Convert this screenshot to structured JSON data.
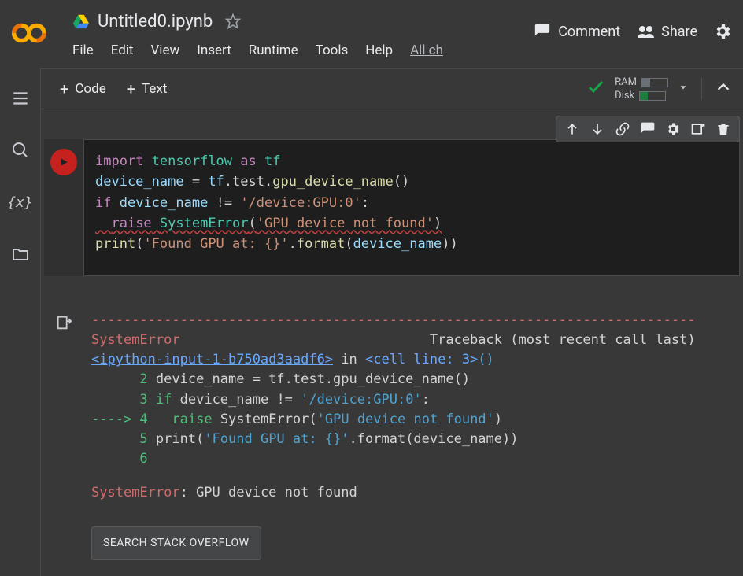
{
  "header": {
    "filename": "Untitled0.ipynb",
    "menu": [
      "File",
      "Edit",
      "View",
      "Insert",
      "Runtime",
      "Tools",
      "Help"
    ],
    "menu_extra_link": "All ch",
    "actions": {
      "comment": "Comment",
      "share": "Share"
    }
  },
  "toolbar": {
    "code_label": "Code",
    "text_label": "Text",
    "resources": {
      "ram_label": "RAM",
      "disk_label": "Disk"
    }
  },
  "code": {
    "l1": {
      "import": "import",
      "mod": "tensorflow",
      "as": "as",
      "alias": "tf"
    },
    "l2": {
      "lhs": "device_name",
      "eq": " = ",
      "a": "tf",
      "b": ".test.",
      "fn": "gpu_device_name",
      "par": "()"
    },
    "l3": {
      "if": "if",
      "sp1": " ",
      "var": "device_name",
      "sp2": " ",
      "neq": "!=",
      "sp3": " ",
      "str": "'/device:GPU:0'",
      "colon": ":"
    },
    "l4": {
      "indent": "  ",
      "raise": "raise",
      "sp": " ",
      "err": "SystemError",
      "open": "(",
      "str": "'GPU device not found'",
      "close": ")"
    },
    "l5": {
      "fn": "print",
      "open": "(",
      "str": "'Found GPU at: {}'",
      "dot": ".",
      "fmt": "format",
      "open2": "(",
      "arg": "device_name",
      "close2": ")",
      "close": ")"
    }
  },
  "output": {
    "err_name": "SystemError",
    "traceback_label": "Traceback (most recent call last)",
    "link_text": "<ipython-input-1-b750ad3aadf6>",
    "in_word": " in ",
    "cell_line": "<cell line: 3>",
    "paren": "()",
    "lines": [
      {
        "num": "      2",
        "body": " device_name = tf.test.gpu_device_name()"
      },
      {
        "num": "      3",
        "body_pre": " ",
        "kw": "if",
        "body_post": " device_name != ",
        "str": "'/device:GPU:0'",
        "tail": ":"
      },
      {
        "arrow": "----> ",
        "num": "4",
        "body_pre": "   ",
        "kw": "raise",
        "body_post": " SystemError(",
        "str": "'GPU device not found'",
        "tail": ")"
      },
      {
        "num": "      5",
        "body_pre": " print(",
        "str": "'Found GPU at: {}'",
        "body_post": ".format(device_name))"
      },
      {
        "num": "      6",
        "body": ""
      }
    ],
    "final_err": "SystemError",
    "final_msg": ": GPU device not found",
    "so_button": "SEARCH STACK OVERFLOW"
  }
}
